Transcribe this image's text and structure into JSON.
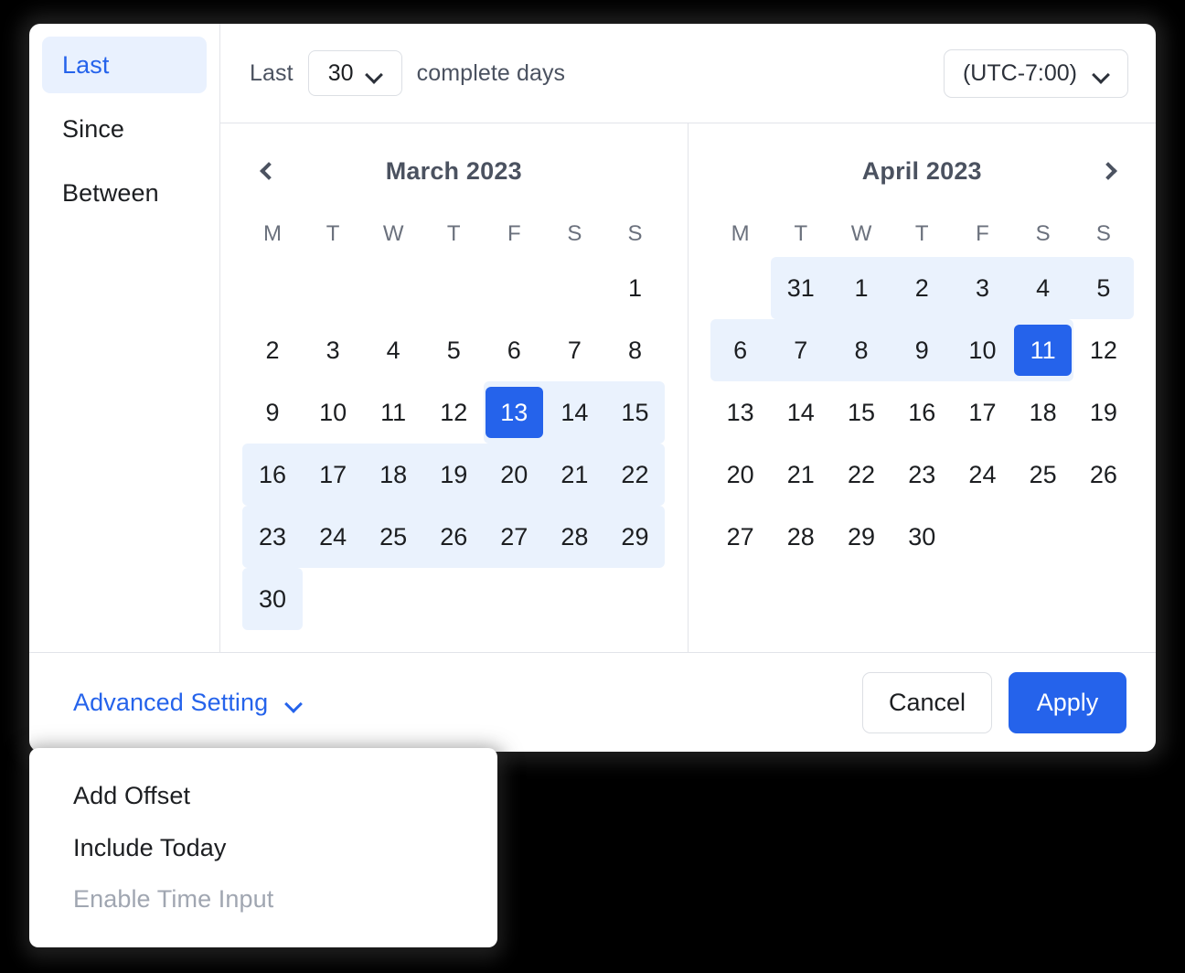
{
  "sidebar": {
    "items": [
      {
        "label": "Last",
        "active": true
      },
      {
        "label": "Since",
        "active": false
      },
      {
        "label": "Between",
        "active": false
      }
    ]
  },
  "range_header": {
    "prefix_label": "Last",
    "count_value": "30",
    "count_icon": "chevron-down-icon",
    "suffix_label": "complete days",
    "timezone_value": "(UTC-7:00)",
    "timezone_icon": "chevron-down-icon"
  },
  "calendars": [
    {
      "title": "March 2023",
      "prev_icon": "chevron-left-icon",
      "next_icon": "chevron-right-icon",
      "show_prev": true,
      "show_next": false,
      "dow": [
        "M",
        "T",
        "W",
        "T",
        "F",
        "S",
        "S"
      ],
      "weeks": [
        [
          {
            "label": "",
            "state": "empty"
          },
          {
            "label": "",
            "state": "empty"
          },
          {
            "label": "",
            "state": "empty"
          },
          {
            "label": "",
            "state": "empty"
          },
          {
            "label": "",
            "state": "empty"
          },
          {
            "label": "",
            "state": "empty"
          },
          {
            "label": "1",
            "state": "normal"
          }
        ],
        [
          {
            "label": "2",
            "state": "normal"
          },
          {
            "label": "3",
            "state": "normal"
          },
          {
            "label": "4",
            "state": "normal"
          },
          {
            "label": "5",
            "state": "normal"
          },
          {
            "label": "6",
            "state": "normal"
          },
          {
            "label": "7",
            "state": "normal"
          },
          {
            "label": "8",
            "state": "normal"
          }
        ],
        [
          {
            "label": "9",
            "state": "normal"
          },
          {
            "label": "10",
            "state": "normal"
          },
          {
            "label": "11",
            "state": "normal"
          },
          {
            "label": "12",
            "state": "normal"
          },
          {
            "label": "13",
            "state": "selected-start"
          },
          {
            "label": "14",
            "state": "inrange"
          },
          {
            "label": "15",
            "state": "inrange-end-edge"
          }
        ],
        [
          {
            "label": "16",
            "state": "inrange-start-edge"
          },
          {
            "label": "17",
            "state": "inrange"
          },
          {
            "label": "18",
            "state": "inrange"
          },
          {
            "label": "19",
            "state": "inrange"
          },
          {
            "label": "20",
            "state": "inrange"
          },
          {
            "label": "21",
            "state": "inrange"
          },
          {
            "label": "22",
            "state": "inrange-end-edge"
          }
        ],
        [
          {
            "label": "23",
            "state": "inrange-start-edge"
          },
          {
            "label": "24",
            "state": "inrange"
          },
          {
            "label": "25",
            "state": "inrange"
          },
          {
            "label": "26",
            "state": "inrange"
          },
          {
            "label": "27",
            "state": "inrange"
          },
          {
            "label": "28",
            "state": "inrange"
          },
          {
            "label": "29",
            "state": "inrange-end-edge"
          }
        ],
        [
          {
            "label": "30",
            "state": "inrange-both-edge"
          },
          {
            "label": "",
            "state": "empty"
          },
          {
            "label": "",
            "state": "empty"
          },
          {
            "label": "",
            "state": "empty"
          },
          {
            "label": "",
            "state": "empty"
          },
          {
            "label": "",
            "state": "empty"
          },
          {
            "label": "",
            "state": "empty"
          }
        ]
      ]
    },
    {
      "title": "April 2023",
      "prev_icon": "chevron-left-icon",
      "next_icon": "chevron-right-icon",
      "show_prev": false,
      "show_next": true,
      "dow": [
        "M",
        "T",
        "W",
        "T",
        "F",
        "S",
        "S"
      ],
      "weeks": [
        [
          {
            "label": "",
            "state": "empty"
          },
          {
            "label": "31",
            "state": "inrange-start-edge"
          },
          {
            "label": "1",
            "state": "inrange"
          },
          {
            "label": "2",
            "state": "inrange"
          },
          {
            "label": "3",
            "state": "inrange"
          },
          {
            "label": "4",
            "state": "inrange"
          },
          {
            "label": "5",
            "state": "inrange-end-edge"
          }
        ],
        [
          {
            "label": "6",
            "state": "inrange-start-edge"
          },
          {
            "label": "7",
            "state": "inrange"
          },
          {
            "label": "8",
            "state": "inrange"
          },
          {
            "label": "9",
            "state": "inrange"
          },
          {
            "label": "10",
            "state": "inrange"
          },
          {
            "label": "11",
            "state": "selected-end"
          },
          {
            "label": "12",
            "state": "normal"
          }
        ],
        [
          {
            "label": "13",
            "state": "normal"
          },
          {
            "label": "14",
            "state": "normal"
          },
          {
            "label": "15",
            "state": "normal"
          },
          {
            "label": "16",
            "state": "normal"
          },
          {
            "label": "17",
            "state": "normal"
          },
          {
            "label": "18",
            "state": "normal"
          },
          {
            "label": "19",
            "state": "normal"
          }
        ],
        [
          {
            "label": "20",
            "state": "normal"
          },
          {
            "label": "21",
            "state": "normal"
          },
          {
            "label": "22",
            "state": "normal"
          },
          {
            "label": "23",
            "state": "normal"
          },
          {
            "label": "24",
            "state": "normal"
          },
          {
            "label": "25",
            "state": "normal"
          },
          {
            "label": "26",
            "state": "normal"
          }
        ],
        [
          {
            "label": "27",
            "state": "normal"
          },
          {
            "label": "28",
            "state": "normal"
          },
          {
            "label": "29",
            "state": "normal"
          },
          {
            "label": "30",
            "state": "normal"
          },
          {
            "label": "",
            "state": "empty"
          },
          {
            "label": "",
            "state": "empty"
          },
          {
            "label": "",
            "state": "empty"
          }
        ]
      ]
    }
  ],
  "footer": {
    "advanced_label": "Advanced Setting",
    "advanced_icon": "chevron-down-icon",
    "cancel_label": "Cancel",
    "apply_label": "Apply"
  },
  "advanced_menu": {
    "items": [
      {
        "label": "Add Offset",
        "disabled": false
      },
      {
        "label": "Include Today",
        "disabled": false
      },
      {
        "label": "Enable Time Input",
        "disabled": true
      }
    ]
  },
  "colors": {
    "accent": "#2563eb",
    "range_band": "#eaf2fd",
    "sidebar_active_bg": "#e9f1fe",
    "border": "#e2e4e9",
    "text": "#1c1e21",
    "muted_text": "#6b717d",
    "disabled_text": "#a0a6b1"
  }
}
